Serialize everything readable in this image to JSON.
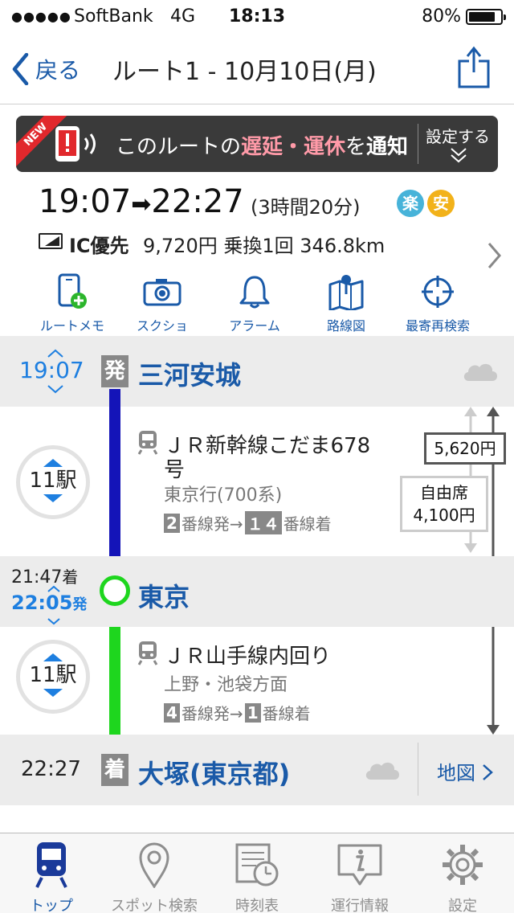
{
  "status_bar": {
    "signal": "●●●●●",
    "carrier": "SoftBank",
    "network": "4G",
    "time": "18:13",
    "battery": "80%"
  },
  "nav": {
    "back_label": "戻る",
    "title": "ルート1 - 10月10日(月)"
  },
  "banner": {
    "ribbon": "NEW",
    "text_pre": "このルートの",
    "text_delay": "遅延・運休",
    "text_mid": "を",
    "text_notify": "通知",
    "settings": "設定する"
  },
  "summary": {
    "depart": "19:07",
    "arrow": "➡",
    "arrive": "22:27",
    "duration": "(3時間20分)",
    "badge_raku": "楽",
    "badge_an": "安",
    "ic_label": "IC優先",
    "fare": "9,720円",
    "transfers": "乗換1回",
    "distance": "346.8km"
  },
  "tools": [
    {
      "label": "ルートメモ",
      "icon": "route-memo-icon"
    },
    {
      "label": "スクショ",
      "icon": "camera-icon"
    },
    {
      "label": "アラーム",
      "icon": "bell-icon"
    },
    {
      "label": "路線図",
      "icon": "route-map-icon"
    },
    {
      "label": "最寄再検索",
      "icon": "target-icon"
    }
  ],
  "route": {
    "origin": {
      "time": "19:07",
      "mark": "発",
      "name": "三河安城"
    },
    "leg1": {
      "stops": "11駅",
      "train": "ＪＲ新幹線こだま678",
      "train_cont": "号",
      "direction": "東京行(700系)",
      "plat_from": "2",
      "plat_from_suffix": "番線発→",
      "plat_to": "１４",
      "plat_to_suffix": "番線着",
      "fare_total": "5,620円",
      "seat_type": "自由席",
      "seat_fare": "4,100円"
    },
    "transfer": {
      "arrive_time": "21:47",
      "arrive_suffix": "着",
      "depart_time": "22:05",
      "depart_suffix": "発",
      "name": "東京"
    },
    "leg2": {
      "stops": "11駅",
      "train": "ＪＲ山手線内回り",
      "direction": "上野・池袋方面",
      "plat_from": "4",
      "plat_from_suffix": "番線発→",
      "plat_to": "1",
      "plat_to_suffix": "番線着"
    },
    "destination": {
      "time": "22:27",
      "mark": "着",
      "name": "大塚(東京都)",
      "map_link": "地図"
    }
  },
  "tabbar": [
    {
      "label": "トップ",
      "icon": "train-icon",
      "active": true
    },
    {
      "label": "スポット検索",
      "icon": "map-pin-icon",
      "active": false
    },
    {
      "label": "時刻表",
      "icon": "timetable-icon",
      "active": false
    },
    {
      "label": "運行情報",
      "icon": "info-icon",
      "active": false
    },
    {
      "label": "設定",
      "icon": "gear-icon",
      "active": false
    }
  ],
  "colors": {
    "accent_blue": "#1a5aa8",
    "time_blue": "#1e7fe0",
    "line_tokaido": "#1414b8",
    "line_yamanote": "#1ed61e"
  }
}
